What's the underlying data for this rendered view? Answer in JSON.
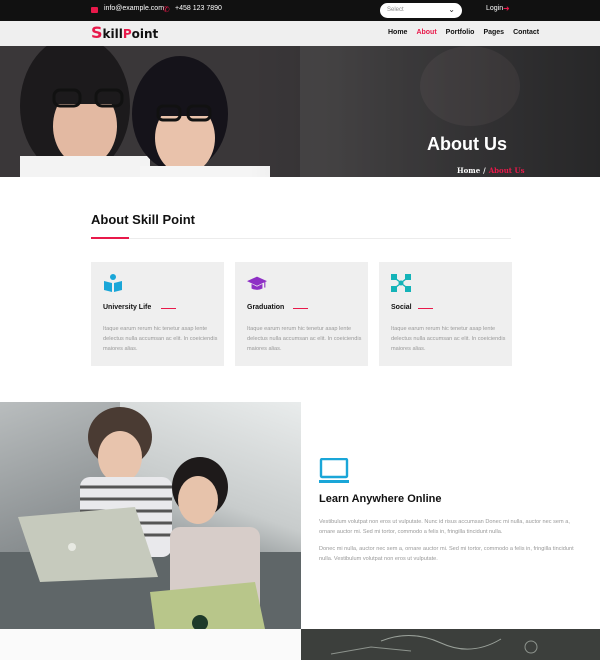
{
  "topbar": {
    "email": "info@example.com",
    "phone": "+458 123 7890",
    "select_value": "Select",
    "login_label": "Login"
  },
  "navbar": {
    "logo_big": "S",
    "logo_kill": "kill",
    "logo_p": "P",
    "logo_oint": "oint",
    "items": [
      "Home",
      "About",
      "Portfolio",
      "Pages",
      "Contact"
    ],
    "active_index": 1
  },
  "hero": {
    "title": "About Us",
    "breadcrumb_home": "Home",
    "breadcrumb_sep": "/",
    "breadcrumb_current": "About Us"
  },
  "about": {
    "title": "About Skill Point",
    "cards": [
      {
        "title": "University Life",
        "icon": "book-reader-icon",
        "text": "Itaque earum rerum hic tenetur asap lente delectus nulla accumsan ac elit. In coeiciendis maiores alias."
      },
      {
        "title": "Graduation",
        "icon": "graduation-cap-icon",
        "text": "Itaque earum rerum hic tenetur asap lente delectus nulla accumsan ac elit. In coeiciendis maiores alias."
      },
      {
        "title": "Social",
        "icon": "network-icon",
        "text": "Itaque earum rerum hic tenetur asap lente delectus nulla accumsan ac elit. In coeiciendis maiores alias."
      }
    ]
  },
  "learn": {
    "title": "Learn Anywhere Online",
    "p1": "Vestibulum volutpat non eros ut vulputate. Nunc id risus accumsan Donec mi nulla, auctor nec sem a, ornare auctor mi. Sed mi tortor, commodo a felis in, fringilla tincidunt nulla.",
    "p2": "Donec mi nulla, auctor nec sem a, ornare auctor mi. Sed mi tortor, commodo a felis in, fringilla tincidunt nulla. Vestibulum volutpat non eros ut vulputate."
  },
  "colors": {
    "accent": "#e8194a",
    "icon_blue": "#1aa6d8",
    "icon_purple": "#8e2fc5",
    "icon_teal": "#14b3b8"
  }
}
